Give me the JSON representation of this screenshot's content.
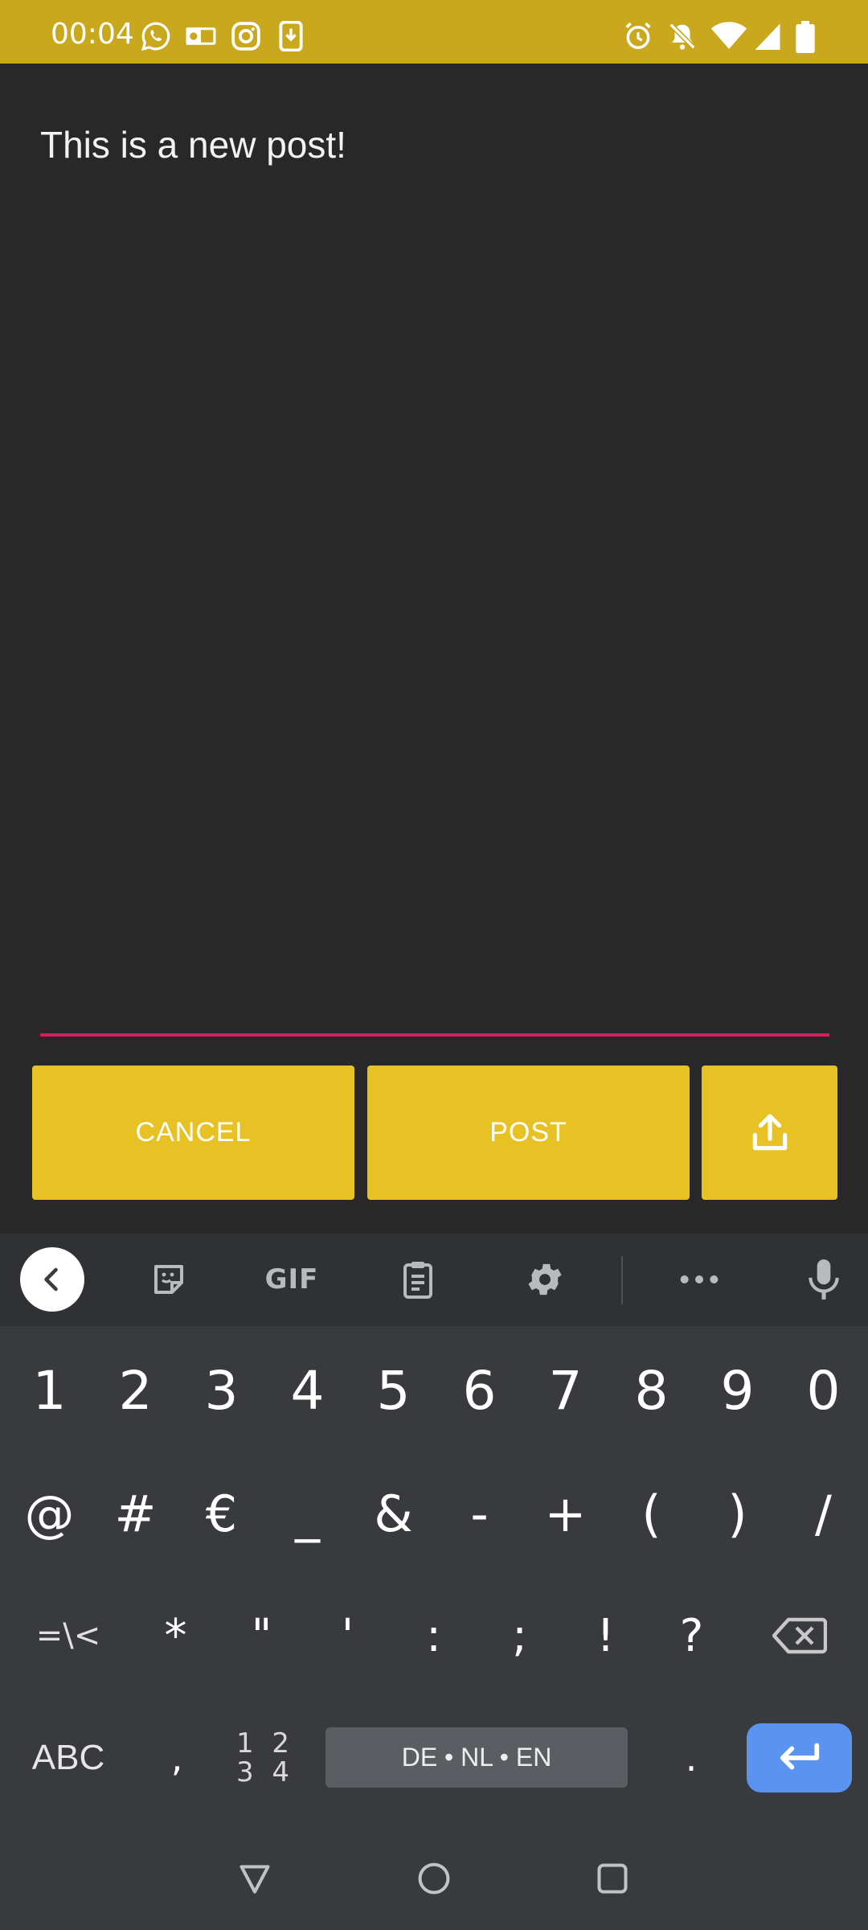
{
  "status_bar": {
    "time": "00:04",
    "left_icons": [
      "whatsapp-icon",
      "outlook-icon",
      "instagram-icon",
      "download-icon"
    ],
    "right_icons": [
      "alarm-icon",
      "bell-off-icon",
      "wifi-icon",
      "signal-icon",
      "battery-icon"
    ],
    "background": "#c9a81e"
  },
  "compose": {
    "text": "This is a new post!",
    "underline_color": "#d81b60"
  },
  "actions": {
    "cancel_label": "CANCEL",
    "post_label": "POST",
    "share_icon": "share-upload-icon",
    "button_color": "#e8c125"
  },
  "keyboard": {
    "toolbar": {
      "items": [
        "back-icon",
        "sticker-icon",
        "GIF",
        "clipboard-icon",
        "settings-icon",
        "more-icon",
        "mic-icon"
      ],
      "gif_label": "GIF"
    },
    "row1": [
      "1",
      "2",
      "3",
      "4",
      "5",
      "6",
      "7",
      "8",
      "9",
      "0"
    ],
    "row2": [
      "@",
      "#",
      "€",
      "_",
      "&",
      "-",
      "+",
      "(",
      ")",
      "/"
    ],
    "row3": [
      "=\\<",
      "*",
      "\"",
      "'",
      ":",
      ";",
      "!",
      "?"
    ],
    "row4": {
      "abc": "ABC",
      "comma": ",",
      "numpad": "1 2\n3 4",
      "space_label": "DE • NL • EN",
      "period": "."
    },
    "enter_color": "#5b94f0"
  },
  "navbar": {
    "icons": [
      "back-triangle-icon",
      "home-circle-icon",
      "recents-square-icon"
    ]
  }
}
